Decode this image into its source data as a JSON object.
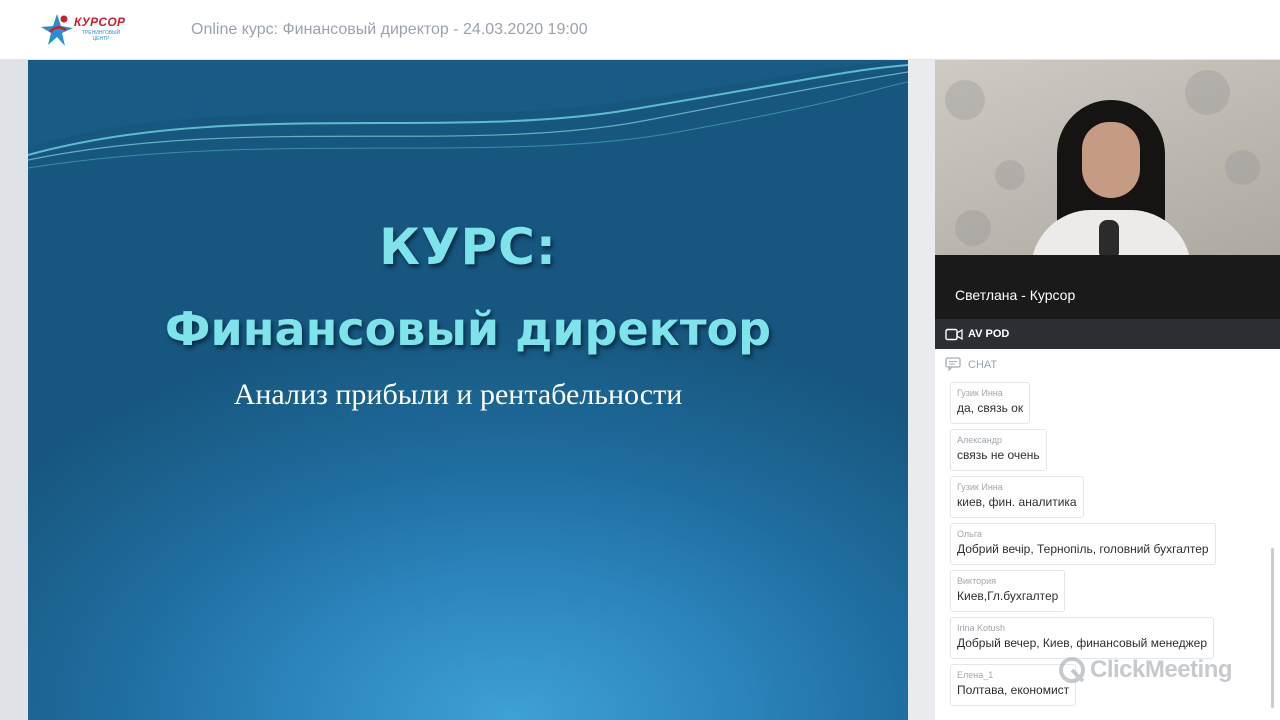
{
  "header": {
    "logo_word": "КУРСОР",
    "logo_sub": "тренинговый центр",
    "title": "Online курс: Финансовый директор - 24.03.2020 19:00"
  },
  "slide": {
    "title_line1": "КУРС:",
    "title_line2": "Финансовый директор",
    "subtitle": "Анализ прибыли и рентабельности"
  },
  "video": {
    "presenter_name": "Светлана - Курсор"
  },
  "av_pod": {
    "label": "AV POD",
    "icon": "video-camera-icon"
  },
  "chat": {
    "label": "CHAT",
    "icon": "chat-icon",
    "messages": [
      {
        "author": "Гузик Инна",
        "text": "да, связь ок"
      },
      {
        "author": "Александр",
        "text": "связь не очень"
      },
      {
        "author": "Гузик Инна",
        "text": "киев, фин. аналитика"
      },
      {
        "author": "Ольга",
        "text": "Добрий вечір, Тернопіль, головний бухгалтер"
      },
      {
        "author": "Виктория",
        "text": "Киев,Гл.бухгалтер"
      },
      {
        "author": "Irina Kotush",
        "text": "Добрый вечер, Киев, финансовый менеджер"
      },
      {
        "author": "Елена_1",
        "text": "Полтава, економист"
      }
    ]
  },
  "watermark": {
    "text": "ClickMeeting"
  },
  "colors": {
    "slide_title": "#7ee3ea",
    "av_bar": "#2b2f33",
    "logo_red": "#c8202f",
    "logo_blue": "#2a8fd0"
  }
}
